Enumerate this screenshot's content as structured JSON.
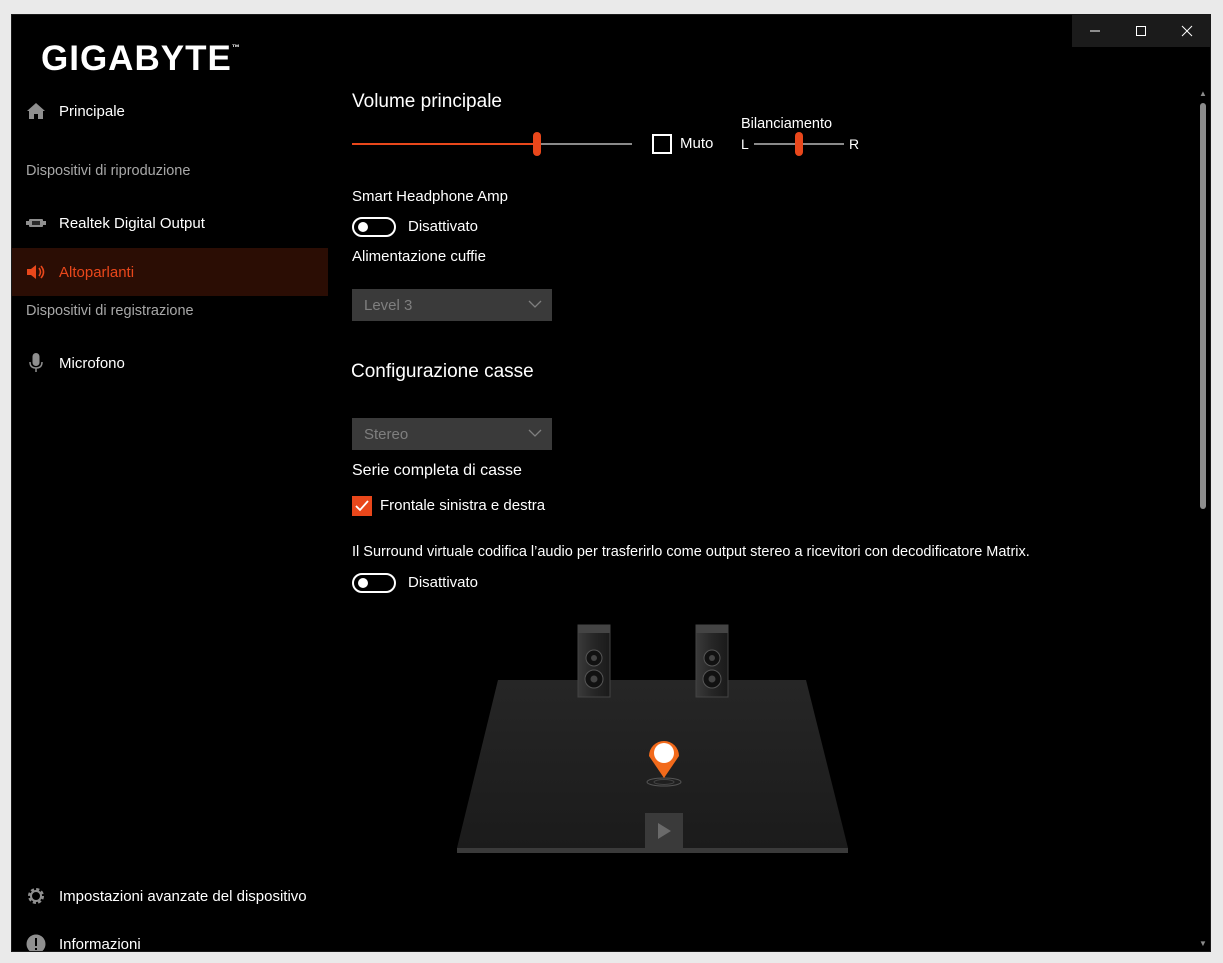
{
  "window": {
    "controls": {
      "minimize": "—",
      "maximize": "☐",
      "close": "✕"
    }
  },
  "logo": {
    "text": "GIGABYTE",
    "mark": "™"
  },
  "sidebar": {
    "home": "Principale",
    "playback_section": "Dispositivi di riproduzione",
    "playback_items": [
      "Realtek Digital Output",
      "Altoparlanti"
    ],
    "recording_section": "Dispositivi di registrazione",
    "recording_items": [
      "Microfono"
    ],
    "advanced_settings": "Impostazioni avanzate del dispositivo",
    "info": "Informazioni",
    "active_item": "Altoparlanti"
  },
  "main": {
    "volume_title": "Volume principale",
    "volume_level": 0.66,
    "mute_label": "Muto",
    "mute_checked": false,
    "balance_title": "Bilanciamento",
    "balance_left": "L",
    "balance_right": "R",
    "balance_level": 0.5,
    "headphone_amp_label": "Smart Headphone Amp",
    "headphone_amp_state": "Disattivato",
    "headphone_power_label": "Alimentazione cuffie",
    "headphone_power_value": "Level 3",
    "speaker_config_title": "Configurazione casse",
    "speaker_config_value": "Stereo",
    "full_range_title": "Serie completa di casse",
    "front_lr_label": "Frontale sinistra e destra",
    "front_lr_checked": true,
    "surround_description": "Il Surround virtuale codifica l’audio per trasferirlo come output stereo a ricevitori con decodificatore Matrix.",
    "surround_state": "Disattivato"
  },
  "colors": {
    "accent": "#e9471b",
    "background": "#000000",
    "sidebar_active_bg": "#2b0d04",
    "muted_text": "#a8a8a8"
  }
}
